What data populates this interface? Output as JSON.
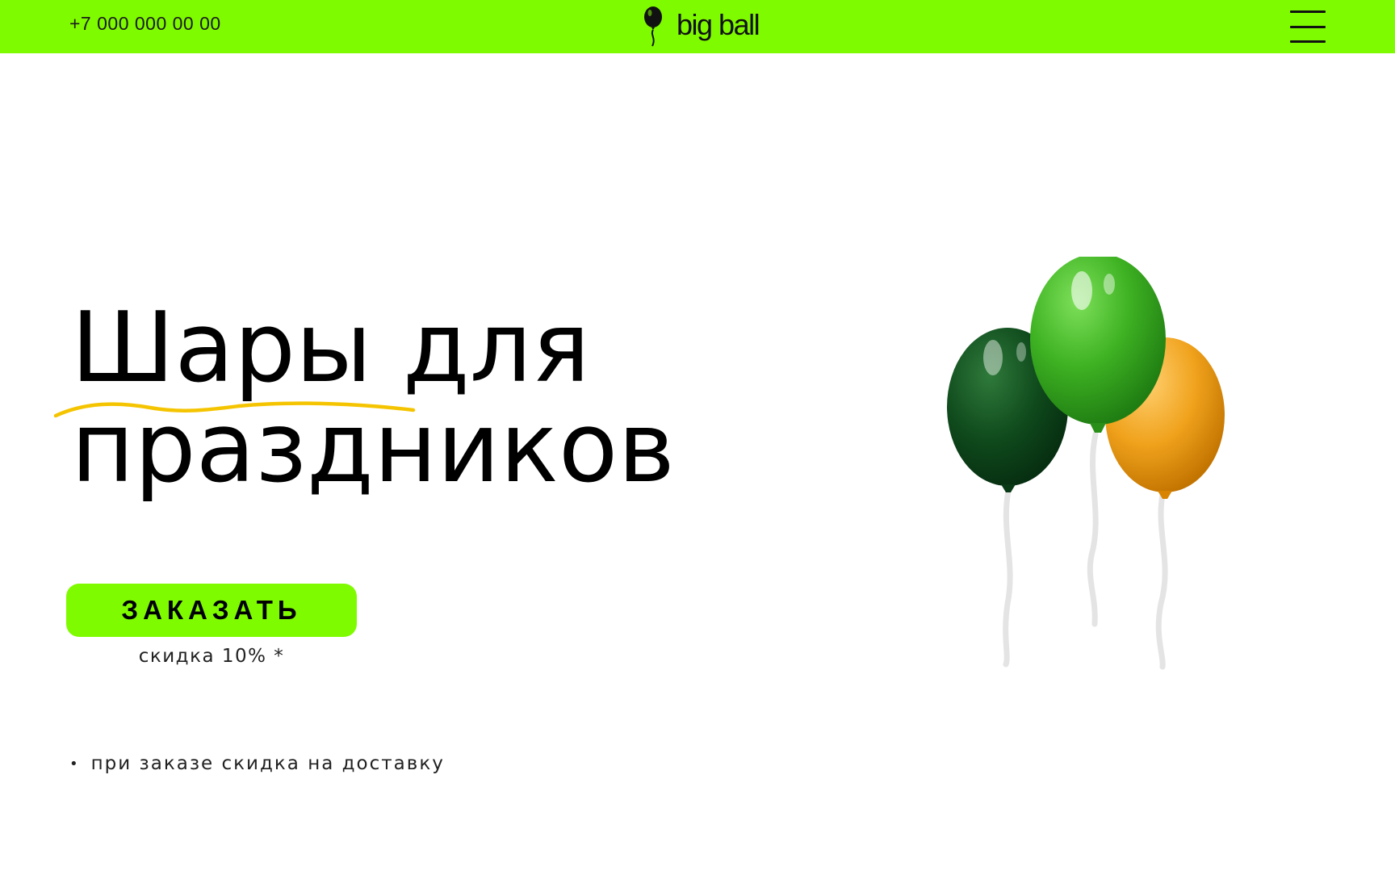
{
  "header": {
    "phone": "+7 000 000 00 00",
    "logo_text": "big ball",
    "menu_icon": "hamburger-menu-icon"
  },
  "hero": {
    "title_line1": "Шары для",
    "title_line2": "праздников",
    "cta_label": "ЗАКАЗАТЬ",
    "discount": "скидка 10% *",
    "note": "при заказе скидка на доставку",
    "bullet": "•"
  },
  "colors": {
    "accent": "#7ffb00",
    "squiggle": "#f5c400",
    "balloon_dark_green": "#0f4a1c",
    "balloon_green": "#3fb323",
    "balloon_orange": "#f0a21c"
  }
}
